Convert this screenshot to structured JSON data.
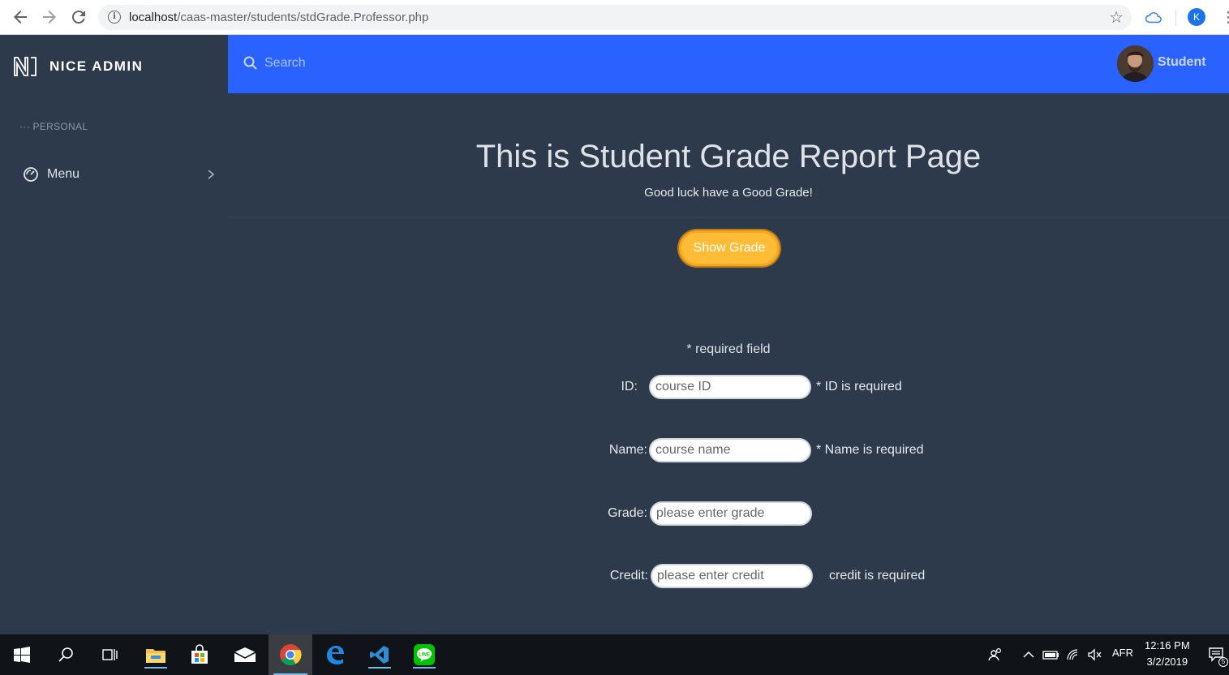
{
  "browser": {
    "url_host": "localhost",
    "url_path": "/caas-master/students/stdGrade.Professor.php",
    "profile_initial": "K"
  },
  "sidebar": {
    "brand": "NICE ADMIN",
    "section_label": "PERSONAL",
    "items": [
      {
        "label": "Menu",
        "icon": "dashboard-icon"
      }
    ]
  },
  "topbar": {
    "search_placeholder": "Search",
    "user_name": "Student",
    "accent": "#2962ff"
  },
  "main": {
    "title": "This is Student Grade Report Page",
    "subtitle": "Good luck have a Good Grade!",
    "show_button": "Show Grade",
    "required_note": "* required field",
    "fields": {
      "id": {
        "label": "ID:",
        "placeholder": "course ID",
        "error": "* ID is required"
      },
      "name": {
        "label": "Name:",
        "placeholder": "course name",
        "error": "* Name is required"
      },
      "grade": {
        "label": "Grade:",
        "placeholder": "please enter grade"
      },
      "credit": {
        "label": "Credit:",
        "placeholder": "please enter credit",
        "error": "credit is required"
      }
    }
  },
  "taskbar": {
    "language": "AFR",
    "time": "12:16 PM",
    "date": "3/2/2019",
    "notification_count": "5"
  },
  "colors": {
    "sidebar_bg": "#2d3a4b",
    "button": "#ffbc34"
  }
}
